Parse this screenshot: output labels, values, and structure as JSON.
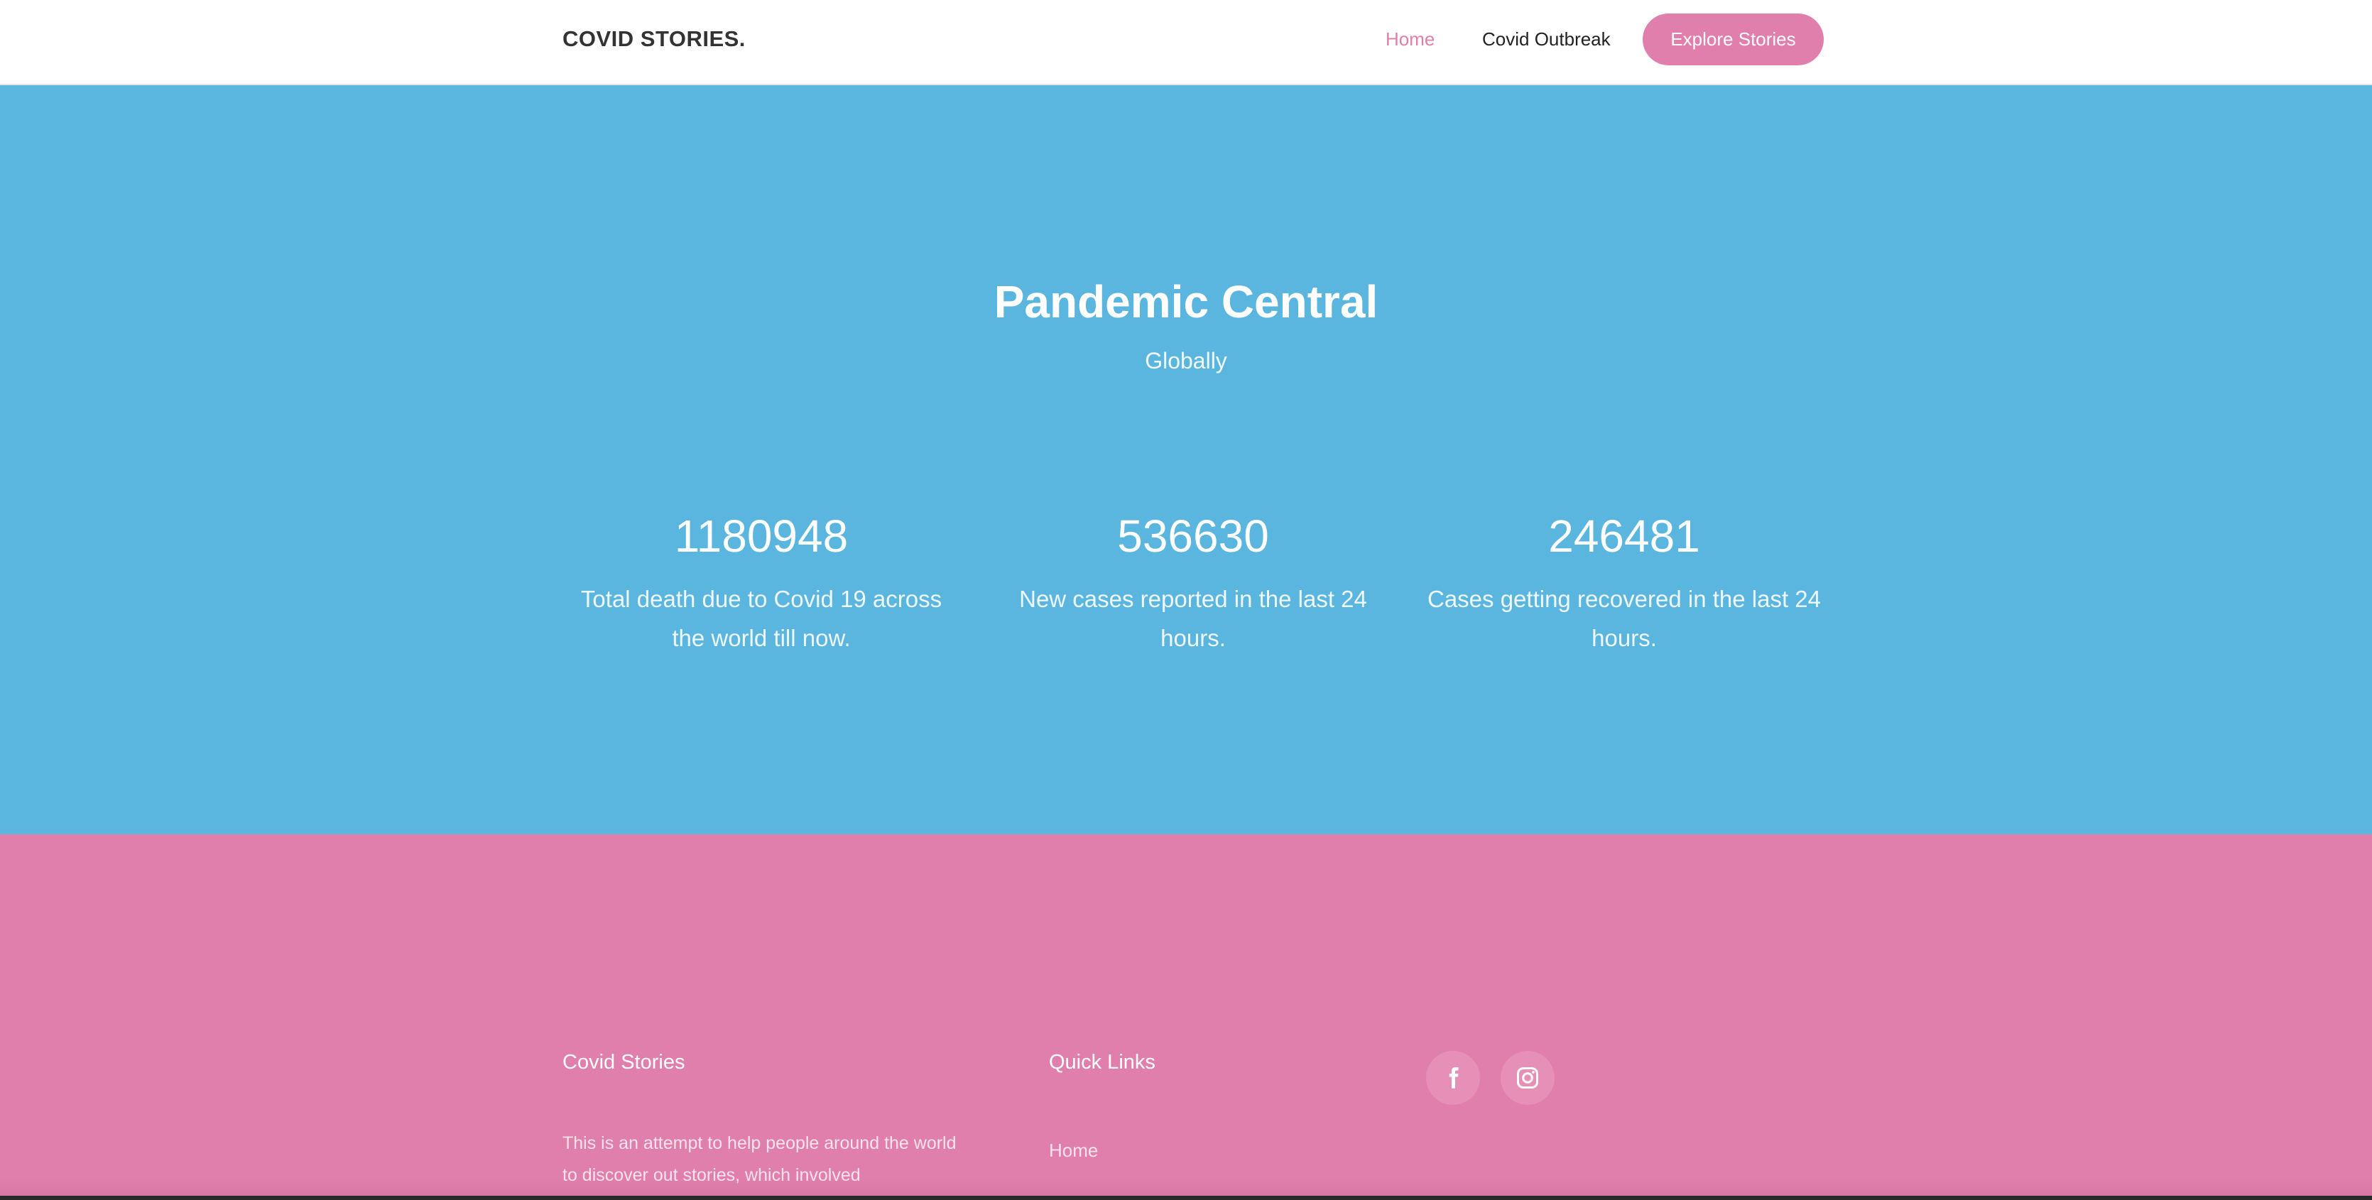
{
  "navbar": {
    "brand": "COVID STORIES.",
    "links": [
      {
        "label": "Home",
        "active": true
      },
      {
        "label": "Covid Outbreak",
        "active": false
      }
    ],
    "cta_label": "Explore Stories"
  },
  "hero": {
    "title": "Pandemic Central",
    "subtitle": "Globally",
    "stats": [
      {
        "value": "1180948",
        "description": "Total death due to Covid 19 across the world till now."
      },
      {
        "value": "536630",
        "description": "New cases reported in the last 24 hours."
      },
      {
        "value": "246481",
        "description": "Cases getting recovered in the last 24 hours."
      }
    ]
  },
  "footer": {
    "about_heading": "Covid Stories",
    "about_text": "This is an attempt to help people around the world to discover out stories, which involved",
    "links_heading": "Quick Links",
    "links": [
      "Home"
    ],
    "social": [
      {
        "icon": "facebook-icon"
      },
      {
        "icon": "instagram-icon"
      }
    ]
  },
  "colors": {
    "accent_pink": "#e07fab",
    "hero_blue": "#5bb6df",
    "text_dark": "#333333"
  }
}
